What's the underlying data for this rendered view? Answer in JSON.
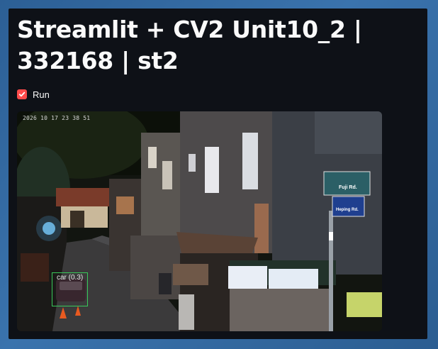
{
  "app": {
    "title": "Streamlit + CV2 Unit10_2 | 332168 | st2"
  },
  "controls": {
    "run_label": "Run",
    "run_checked": true
  },
  "video": {
    "timestamp": "2026 10 17 23 38 51",
    "detection_label": "car (0.3)",
    "street_sign_top": "Fuji Rd.",
    "street_sign_bottom": "Heping Rd."
  },
  "colors": {
    "background": "#0e1117",
    "accent": "#ff4b4b",
    "detection_box": "#39c95a"
  }
}
